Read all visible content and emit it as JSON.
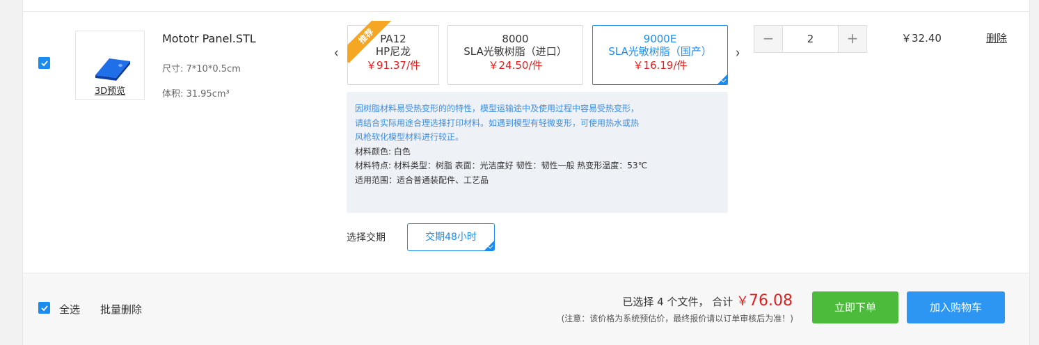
{
  "item": {
    "file_name": "Mototr Panel.STL",
    "size": "尺寸: 7*10*0.5cm",
    "volume": "体积: 31.95cm³",
    "preview_label": "3D预览",
    "checked": true
  },
  "materials": [
    {
      "name": "PA12",
      "type": "HP尼龙",
      "price": "￥91.37",
      "unit": "/件",
      "badge": "推荐",
      "selected": false
    },
    {
      "name": "8000",
      "type": "SLA光敏树脂（进口）",
      "price": "￥24.50",
      "unit": "/件",
      "selected": false
    },
    {
      "name": "9000E",
      "type": "SLA光敏树脂（国产）",
      "price": "￥16.19",
      "unit": "/件",
      "selected": true
    }
  ],
  "info": {
    "warning1": "因树脂材料易受热变形的的特性，模型运输途中及使用过程中容易受热变形，",
    "warning2": "请结合实际用途合理选择打印材料。如遇到模型有轻微变形，可使用热水或热",
    "warning3": "风枪软化模型材料进行较正。",
    "color": "材料颜色: 白色",
    "features": "材料特点: 材料类型：树脂 表面：光洁度好 韧性：韧性一般 热变形温度：53℃",
    "scope": "适用范围：适合普通装配件、工艺品"
  },
  "delivery": {
    "label": "选择交期",
    "option": "交期48小时"
  },
  "quantity": {
    "minus": "−",
    "value": "2",
    "plus": "+"
  },
  "line_price": "￥32.40",
  "delete_label": "删除",
  "footer": {
    "select_all": "全选",
    "batch_delete": "批量删除",
    "selected_text": "已选择 4 个文件，  合计",
    "total_symbol": "￥",
    "total_value": "76.08",
    "note": "(注意：该价格为系统预估价，最终报价请以订单审核后为准！)",
    "order_button": "立即下单",
    "cart_button": "加入购物车"
  },
  "colors": {
    "accent": "#1a8cf0",
    "price_red": "#e02020",
    "order_green": "#4cbb3c",
    "cart_blue": "#2d96f2",
    "badge_orange": "#f5a623"
  }
}
